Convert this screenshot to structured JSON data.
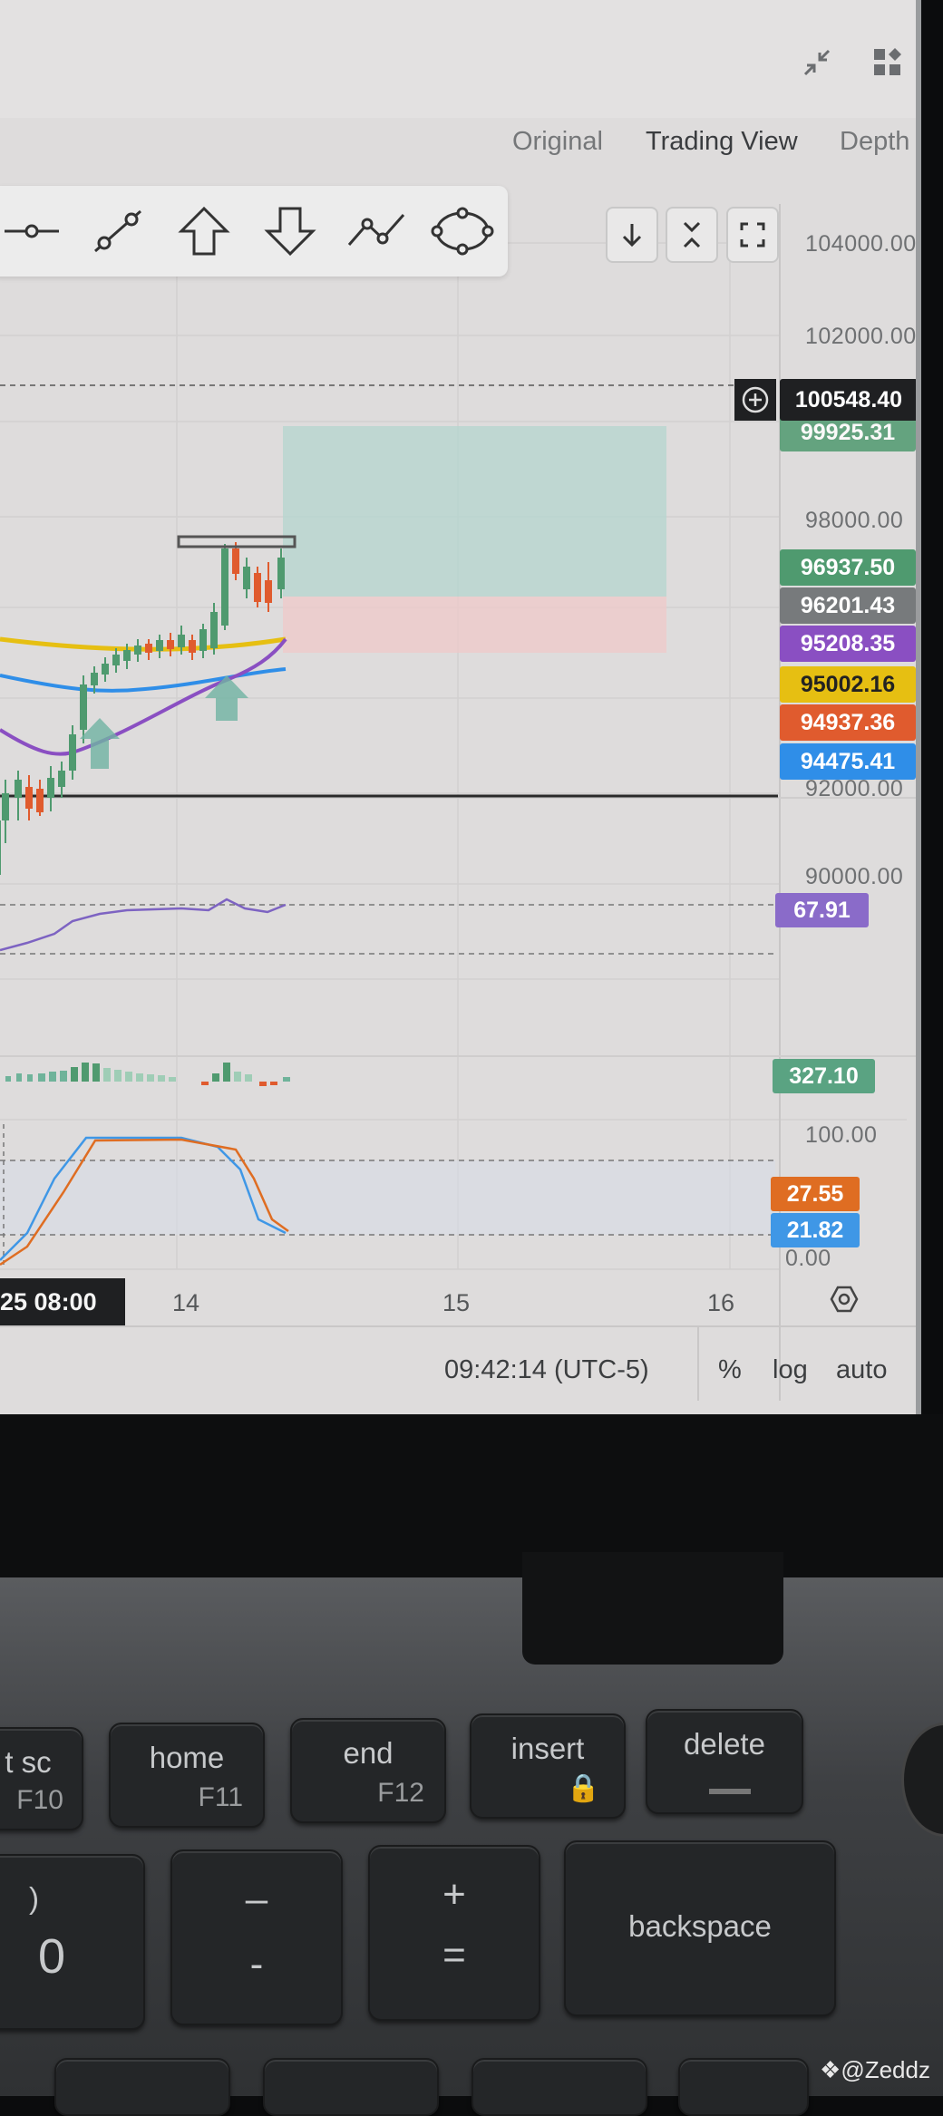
{
  "top_icons": [
    "collapse-icon",
    "layout-grid-icon"
  ],
  "view_tabs": [
    {
      "label": "Original"
    },
    {
      "label": "Trading View"
    },
    {
      "label": "Depth"
    }
  ],
  "drawing_tools": [
    "horizontal-line-icon",
    "trend-line-icon",
    "arrow-up-icon",
    "arrow-down-icon",
    "path-icon",
    "ellipse-icon"
  ],
  "chart_controls": [
    "arrow-down-icon",
    "collapse-vertical-icon",
    "fit-screen-icon"
  ],
  "price_axis": {
    "ticks": [
      "104000.00",
      "102000.00",
      "98000.00",
      "92000.00",
      "90000.00"
    ],
    "crosshair_price": "100548.40",
    "hidden_tag": "99925.31",
    "tags": [
      {
        "name": "last-price",
        "value": "96937.50",
        "color": "#4f9a6f"
      },
      {
        "name": "price-line",
        "value": "96201.43",
        "color": "#777a7c"
      },
      {
        "name": "ma-purple",
        "value": "95208.35",
        "color": "#8a4fc2"
      },
      {
        "name": "ma-yellow",
        "value": "95002.16",
        "color": "#e6bf12"
      },
      {
        "name": "ma-orange",
        "value": "94937.36",
        "color": "#e05b2e"
      },
      {
        "name": "ma-blue",
        "value": "94475.41",
        "color": "#2f8ee8"
      }
    ]
  },
  "rsi": {
    "value": "67.91",
    "color": "#8a6bc9"
  },
  "volume": {
    "value": "327.10",
    "color": "#5aa382"
  },
  "stoch": {
    "top_label": "100.00",
    "bottom_label": "0.00",
    "k_value": "27.55",
    "k_color": "#df6d22",
    "d_value": "21.82",
    "d_color": "#3f97e6"
  },
  "time_axis": {
    "cursor": "25  08:00",
    "labels": [
      "14",
      "15",
      "16"
    ]
  },
  "bottom_bar": {
    "clock": "09:42:14 (UTC-5)",
    "percent": "%",
    "log": "log",
    "auto": "auto"
  },
  "keyboard": {
    "prtsc_top": "t sc",
    "prtsc_bot": "F10",
    "home_top": "home",
    "home_bot": "F11",
    "end_top": "end",
    "end_bot": "F12",
    "insert_top": "insert",
    "delete_top": "delete",
    "paren_top": ")",
    "paren_bot": "0",
    "minus_top": "–",
    "minus_bot": "-",
    "plus_top": "+",
    "plus_bot": "=",
    "backspace": "backspace"
  },
  "watermark": "@Zeddz",
  "chart_data": {
    "type": "candlestick",
    "overlays": [
      "moving averages (purple, yellow, blue)",
      "long position box"
    ],
    "panels": [
      "price",
      "RSI",
      "volume histogram",
      "stochastic"
    ],
    "ylim": [
      90000,
      104000
    ]
  }
}
